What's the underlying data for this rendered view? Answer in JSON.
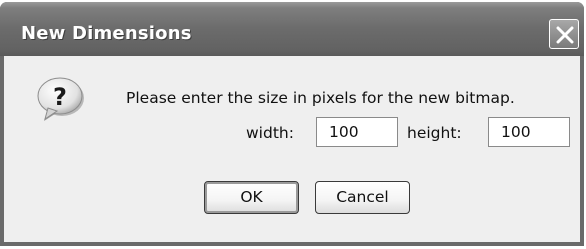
{
  "dialog": {
    "title": "New Dimensions",
    "close_icon": "close-x-icon",
    "question_icon": "question-mark-icon",
    "message": "Please enter the size in pixels for the new bitmap.",
    "width_label": "width:",
    "width_value": "100",
    "height_label": "height:",
    "height_value": "100",
    "ok_label": "OK",
    "cancel_label": "Cancel"
  }
}
